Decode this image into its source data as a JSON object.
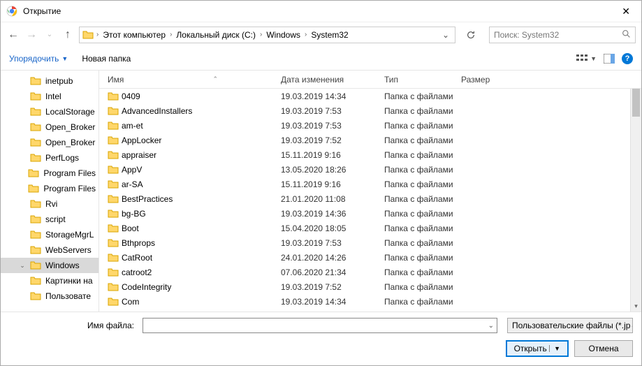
{
  "window": {
    "title": "Открытие"
  },
  "breadcrumbs": [
    "Этот компьютер",
    "Локальный диск (C:)",
    "Windows",
    "System32"
  ],
  "search": {
    "placeholder": "Поиск: System32"
  },
  "toolbar": {
    "organize": "Упорядочить",
    "newfolder": "Новая папка"
  },
  "columns": {
    "name": "Имя",
    "date": "Дата изменения",
    "type": "Тип",
    "size": "Размер"
  },
  "tree": [
    {
      "label": "inetpub"
    },
    {
      "label": "Intel"
    },
    {
      "label": "LocalStorage"
    },
    {
      "label": "Open_Broker"
    },
    {
      "label": "Open_Broker"
    },
    {
      "label": "PerfLogs"
    },
    {
      "label": "Program Files"
    },
    {
      "label": "Program Files"
    },
    {
      "label": "Rvi"
    },
    {
      "label": "script"
    },
    {
      "label": "StorageMgrL"
    },
    {
      "label": "WebServers"
    },
    {
      "label": "Windows",
      "selected": true,
      "expanded": true
    },
    {
      "label": "Картинки на"
    },
    {
      "label": "Пользовате"
    }
  ],
  "files": [
    {
      "name": "0409",
      "date": "19.03.2019 14:34",
      "type": "Папка с файлами"
    },
    {
      "name": "AdvancedInstallers",
      "date": "19.03.2019 7:53",
      "type": "Папка с файлами"
    },
    {
      "name": "am-et",
      "date": "19.03.2019 7:53",
      "type": "Папка с файлами"
    },
    {
      "name": "AppLocker",
      "date": "19.03.2019 7:52",
      "type": "Папка с файлами"
    },
    {
      "name": "appraiser",
      "date": "15.11.2019 9:16",
      "type": "Папка с файлами"
    },
    {
      "name": "AppV",
      "date": "13.05.2020 18:26",
      "type": "Папка с файлами"
    },
    {
      "name": "ar-SA",
      "date": "15.11.2019 9:16",
      "type": "Папка с файлами"
    },
    {
      "name": "BestPractices",
      "date": "21.01.2020 11:08",
      "type": "Папка с файлами"
    },
    {
      "name": "bg-BG",
      "date": "19.03.2019 14:36",
      "type": "Папка с файлами"
    },
    {
      "name": "Boot",
      "date": "15.04.2020 18:05",
      "type": "Папка с файлами"
    },
    {
      "name": "Bthprops",
      "date": "19.03.2019 7:53",
      "type": "Папка с файлами"
    },
    {
      "name": "CatRoot",
      "date": "24.01.2020 14:26",
      "type": "Папка с файлами"
    },
    {
      "name": "catroot2",
      "date": "07.06.2020 21:34",
      "type": "Папка с файлами"
    },
    {
      "name": "CodeIntegrity",
      "date": "19.03.2019 7:52",
      "type": "Папка с файлами"
    },
    {
      "name": "Com",
      "date": "19.03.2019 14:34",
      "type": "Папка с файлами"
    }
  ],
  "footer": {
    "filename_label": "Имя файла:",
    "filename_value": "",
    "filetype": "Пользовательские файлы (*.jp",
    "open": "Открыть",
    "cancel": "Отмена"
  }
}
